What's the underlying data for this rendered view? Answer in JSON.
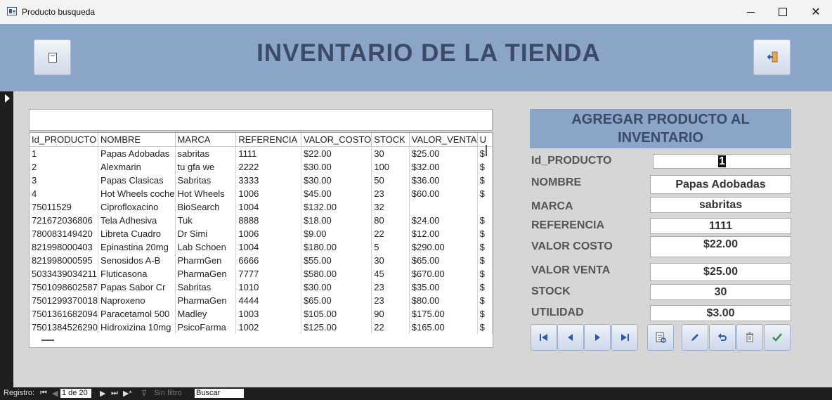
{
  "window": {
    "title": "Producto busqueda",
    "app_icon": "form-icon",
    "controls": {
      "minimize": "minimize-icon",
      "maximize": "maximize-icon",
      "close": "✕"
    }
  },
  "header": {
    "title": "INVENTARIO DE LA TIENDA",
    "left_button_icon": "document-icon",
    "right_button_icon": "exit-door-icon"
  },
  "search": {
    "value": ""
  },
  "grid": {
    "columns": [
      "Id_PRODUCTO",
      "NOMBRE",
      "MARCA",
      "REFERENCIA",
      "VALOR_COSTO",
      "STOCK",
      "VALOR_VENTA",
      "U"
    ],
    "rows": [
      [
        "1",
        "Papas Adobadas",
        "sabritas",
        "1111",
        "$22.00",
        "30",
        "$25.00",
        "$"
      ],
      [
        "2",
        "Alexmarin",
        "tu gfa we",
        "2222",
        "$30.00",
        "100",
        "$32.00",
        "$"
      ],
      [
        "3",
        "Papas Clasicas",
        "Sabritas",
        "3333",
        "$30.00",
        "50",
        "$36.00",
        "$"
      ],
      [
        "4",
        "Hot Wheels coche",
        "Hot Wheels",
        "1006",
        "$45.00",
        "23",
        "$60.00",
        "$"
      ],
      [
        "75011529",
        "Ciprofloxacino",
        "BioSearch",
        "1004",
        "$132.00",
        "32",
        "",
        ""
      ],
      [
        "721672036806",
        "Tela Adhesiva",
        "Tuk",
        "8888",
        "$18.00",
        "80",
        "$24.00",
        "$"
      ],
      [
        "780083149420",
        "Libreta Cuadro",
        "Dr Simi",
        "1006",
        "$9.00",
        "22",
        "$12.00",
        "$"
      ],
      [
        "821998000403",
        "Epinastina 20mg",
        "Lab Schoen",
        "1004",
        "$180.00",
        "5",
        "$290.00",
        "$"
      ],
      [
        "821998000595",
        "Senosidos A-B",
        "PharmGen",
        "6666",
        "$55.00",
        "30",
        "$65.00",
        "$"
      ],
      [
        "5033439034211",
        "Fluticasona",
        "PharmaGen",
        "7777",
        "$580.00",
        "45",
        "$670.00",
        "$"
      ],
      [
        "7501098602587",
        "Papas Sabor Cr",
        "Sabritas",
        "1010",
        "$30.00",
        "23",
        "$35.00",
        "$"
      ],
      [
        "7501299370018",
        "Naproxeno",
        "PharmaGen",
        "4444",
        "$65.00",
        "23",
        "$80.00",
        "$"
      ],
      [
        "7501361682094",
        "Paracetamol 500",
        "Madley",
        "1003",
        "$105.00",
        "90",
        "$175.00",
        "$"
      ],
      [
        "7501384526290",
        "Hidroxizina 10mg",
        "PsicoFarma",
        "1002",
        "$125.00",
        "22",
        "$165.00",
        "$"
      ]
    ]
  },
  "form": {
    "title": "AGREGAR PRODUCTO AL INVENTARIO",
    "fields": [
      {
        "label": "Id_PRODUCTO",
        "value": "1"
      },
      {
        "label": "NOMBRE",
        "value": "Papas Adobadas"
      },
      {
        "label": "MARCA",
        "value": "sabritas"
      },
      {
        "label": "REFERENCIA",
        "value": "1111"
      },
      {
        "label": "VALOR COSTO",
        "value": "$22.00"
      },
      {
        "label": "VALOR VENTA",
        "value": "$25.00"
      },
      {
        "label": "STOCK",
        "value": "30"
      },
      {
        "label": "UTILIDAD",
        "value": "$3.00"
      }
    ],
    "toolbar_icons": [
      "first-record-icon",
      "previous-record-icon",
      "next-record-icon",
      "last-record-icon",
      "report-icon",
      "edit-icon",
      "undo-icon",
      "delete-icon",
      "save-check-icon"
    ]
  },
  "statusbar": {
    "label": "Registro:",
    "position": "1 de 20",
    "filter": "Sin filtro",
    "search_placeholder": "Buscar",
    "nav_icons": [
      "first-icon",
      "prev-icon",
      "next-icon",
      "last-icon",
      "new-record-icon"
    ]
  },
  "colors": {
    "header_bg": "#8aa5c8",
    "header_text": "#3c4a68",
    "status_bg": "#1e1e1e"
  }
}
